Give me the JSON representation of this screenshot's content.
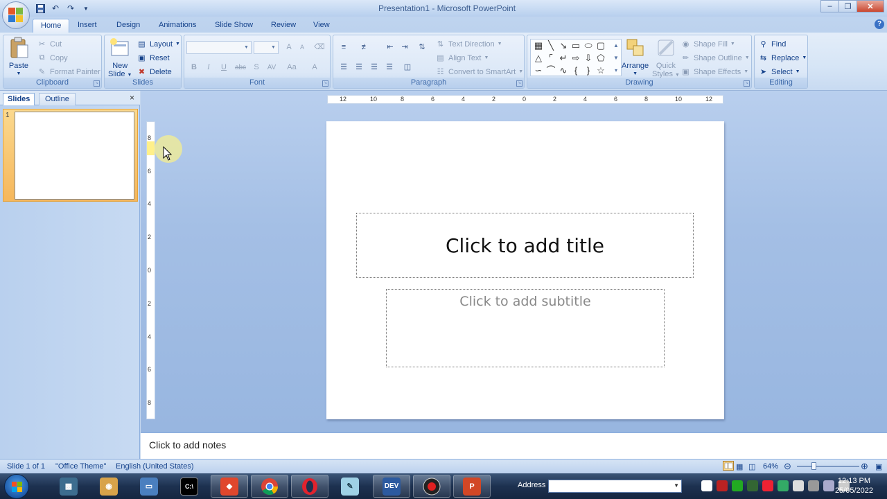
{
  "window": {
    "title": "Presentation1 - Microsoft PowerPoint",
    "controls": [
      "minimize",
      "maximize",
      "close"
    ]
  },
  "tabs": [
    "Home",
    "Insert",
    "Design",
    "Animations",
    "Slide Show",
    "Review",
    "View"
  ],
  "active_tab": "Home",
  "ribbon": {
    "clipboard": {
      "label": "Clipboard",
      "paste": "Paste",
      "cut": "Cut",
      "copy": "Copy",
      "format_painter": "Format Painter"
    },
    "slides": {
      "label": "Slides",
      "new_slide_1": "New",
      "new_slide_2": "Slide",
      "layout": "Layout",
      "reset": "Reset",
      "delete": "Delete"
    },
    "font": {
      "label": "Font",
      "grow": "A",
      "shrink": "A",
      "clear": "",
      "bold": "B",
      "italic": "I",
      "underline": "U",
      "strike": "abc",
      "shadow": "S",
      "spacing": "AV",
      "case": "Aa",
      "color": "A"
    },
    "paragraph": {
      "label": "Paragraph",
      "text_direction": "Text Direction",
      "align_text": "Align Text",
      "convert_smartart": "Convert to SmartArt"
    },
    "drawing": {
      "label": "Drawing",
      "arrange": "Arrange",
      "quick_styles_1": "Quick",
      "quick_styles_2": "Styles",
      "shape_fill": "Shape Fill",
      "shape_outline": "Shape Outline",
      "shape_effects": "Shape Effects"
    },
    "editing": {
      "label": "Editing",
      "find": "Find",
      "replace": "Replace",
      "select": "Select"
    }
  },
  "left_pane": {
    "tab_slides": "Slides",
    "tab_outline": "Outline",
    "close": "×",
    "slide_number": "1"
  },
  "ruler": {
    "horizontal": [
      "12",
      "10",
      "8",
      "6",
      "4",
      "2",
      "0",
      "2",
      "4",
      "6",
      "8",
      "10",
      "12"
    ],
    "vertical": [
      "8",
      "6",
      "4",
      "2",
      "0",
      "2",
      "4",
      "6",
      "8"
    ]
  },
  "slide": {
    "title_placeholder": "Click to add title",
    "subtitle_placeholder": "Click to add subtitle"
  },
  "notes": {
    "placeholder": "Click to add notes"
  },
  "status": {
    "slide": "Slide 1 of 1",
    "theme": "\"Office Theme\"",
    "language": "English (United States)",
    "zoom": "64%"
  },
  "taskbar": {
    "address_label": "Address",
    "time": "12:13 PM",
    "date": "25/05/2022",
    "apps": [
      "computer-app",
      "paint-app",
      "drive-app",
      "cmd-app",
      "git-app",
      "chrome-app",
      "opera-app",
      "notes-app",
      "devc-app",
      "recorder-app",
      "powerpoint-app"
    ]
  },
  "colors": {
    "accent": "#15428b",
    "ribbon_bg": "#dce8f7",
    "slide_selected": "#f6b75b",
    "workspace": "#a4bfe5"
  }
}
